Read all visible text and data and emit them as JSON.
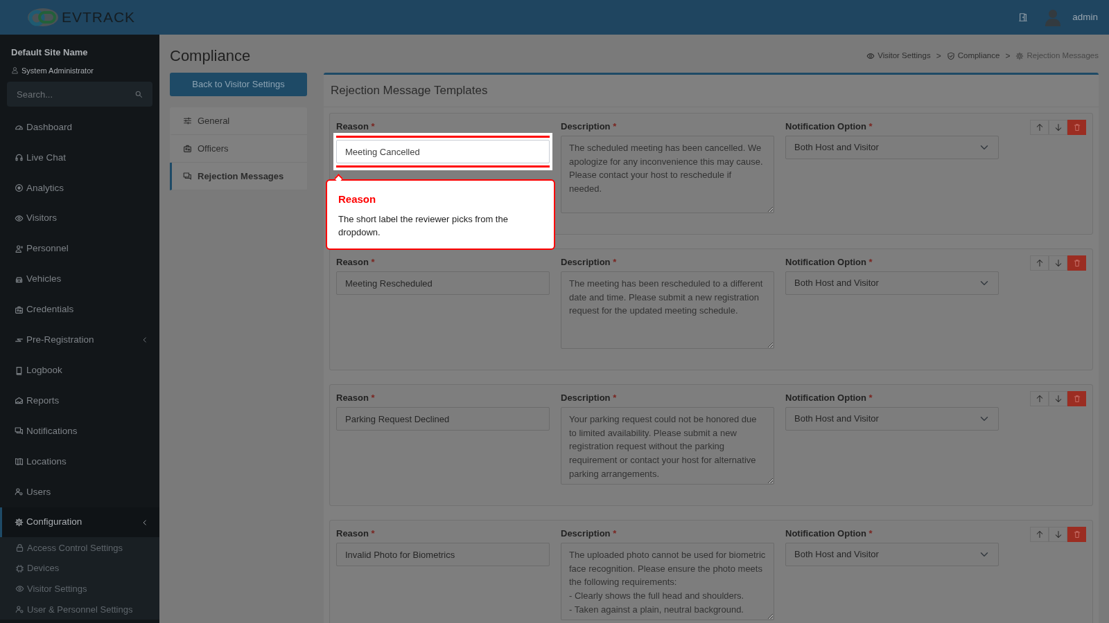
{
  "header": {
    "logo": "**EV**TRACK",
    "user": "admin"
  },
  "sidebar": {
    "site_name": "Default Site Name",
    "role": "System Administrator",
    "search": {
      "placeholder": "Search..."
    },
    "items": [
      {
        "label": "Dashboard",
        "selected": false,
        "submenu": false
      },
      {
        "label": "Live Chat",
        "selected": false,
        "submenu": false
      },
      {
        "label": "Analytics",
        "selected": false,
        "submenu": false
      },
      {
        "label": "Visitors",
        "selected": false,
        "submenu": false
      },
      {
        "label": "Personnel",
        "selected": false,
        "submenu": false
      },
      {
        "label": "Vehicles",
        "selected": false,
        "submenu": false
      },
      {
        "label": "Credentials",
        "selected": false,
        "submenu": false
      },
      {
        "label": "Pre-Registration",
        "selected": false,
        "submenu": true
      },
      {
        "label": "Logbook",
        "selected": false,
        "submenu": false
      },
      {
        "label": "Reports",
        "selected": false,
        "submenu": false
      },
      {
        "label": "Notifications",
        "selected": false,
        "submenu": false
      },
      {
        "label": "Locations",
        "selected": false,
        "submenu": false
      },
      {
        "label": "Users",
        "selected": false,
        "submenu": false
      },
      {
        "label": "Configuration",
        "selected": true,
        "submenu": true,
        "children": [
          {
            "label": "Access Control Settings",
            "selected": false
          },
          {
            "label": "Devices",
            "selected": false
          },
          {
            "label": "Visitor Settings",
            "selected": false
          },
          {
            "label": "User & Personnel Settings",
            "selected": false
          }
        ]
      }
    ]
  },
  "page": {
    "title": "Compliance",
    "breadcrumbs": [
      {
        "label": "Visitor Settings",
        "active": false
      },
      {
        "label": "Compliance",
        "active": false
      },
      {
        "label": "Rejection Messages",
        "active": true
      }
    ],
    "breadcrumb_separator": ">",
    "back_button": "Back to Visitor Settings",
    "settings_nav": [
      {
        "label": "General",
        "selected": false
      },
      {
        "label": "Officers",
        "selected": false
      },
      {
        "label": "Rejection Messages",
        "selected": true
      }
    ],
    "panel_title": "Rejection Message Templates",
    "templates": [
      {
        "fields": [
          {
            "kind": "text",
            "label": "Reason",
            "mark": "*",
            "value": "Meeting Cancelled",
            "spotlight": true
          },
          {
            "kind": "textarea",
            "label": "Description",
            "mark": "*",
            "value": "The scheduled meeting has been cancelled. We apologize for any inconvenience this may cause. Please contact your host to reschedule if needed.",
            "spotlight": false
          },
          {
            "kind": "select",
            "label": "Notification Option",
            "mark": "*",
            "value": "Both Host and Visitor",
            "spotlight": false
          }
        ]
      },
      {
        "fields": [
          {
            "kind": "text",
            "label": "Reason",
            "mark": "*",
            "value": "Meeting Rescheduled",
            "spotlight": false
          },
          {
            "kind": "textarea",
            "label": "Description",
            "mark": "*",
            "value": "The meeting has been rescheduled to a different date and time. Please submit a new registration request for the updated meeting schedule.",
            "spotlight": false
          },
          {
            "kind": "select",
            "label": "Notification Option",
            "mark": "*",
            "value": "Both Host and Visitor",
            "spotlight": false
          }
        ]
      },
      {
        "fields": [
          {
            "kind": "text",
            "label": "Reason",
            "mark": "*",
            "value": "Parking Request Declined",
            "spotlight": false
          },
          {
            "kind": "textarea",
            "label": "Description",
            "mark": "*",
            "value": "Your parking request could not be honored due to limited availability. Please submit a new registration request without the parking requirement or contact your host for alternative parking arrangements.",
            "spotlight": false
          },
          {
            "kind": "select",
            "label": "Notification Option",
            "mark": "*",
            "value": "Both Host and Visitor",
            "spotlight": false
          }
        ]
      },
      {
        "fields": [
          {
            "kind": "text",
            "label": "Reason",
            "mark": "*",
            "value": "Invalid Photo for Biometrics",
            "spotlight": false
          },
          {
            "kind": "textarea",
            "label": "Description",
            "mark": "*",
            "value": "The uploaded photo cannot be used for biometric face recognition. Please ensure the photo meets the following requirements:\n- Clearly shows the full head and shoulders.\n- Taken against a plain, neutral background.",
            "spotlight": false
          },
          {
            "kind": "select",
            "label": "Notification Option",
            "mark": "*",
            "value": "Both Host and Visitor",
            "spotlight": false
          }
        ]
      }
    ]
  },
  "tour_popover": {
    "title": "Reason",
    "text": "The short label the reviewer picks from the dropdown."
  }
}
